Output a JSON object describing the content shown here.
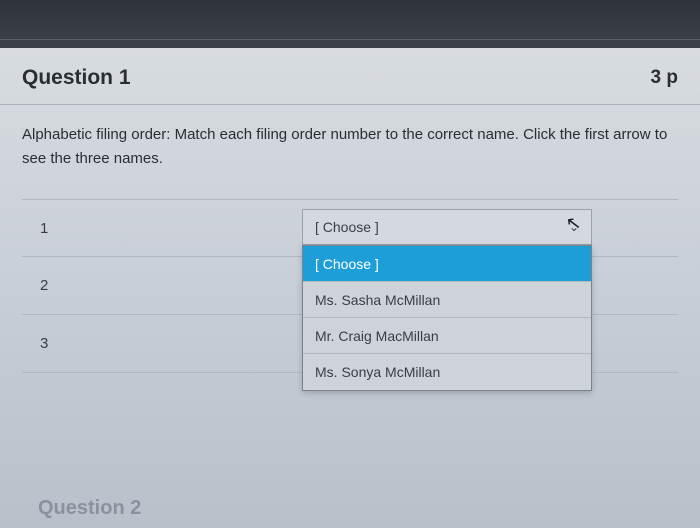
{
  "header": {
    "title": "Question 1",
    "points": "3 p"
  },
  "body": {
    "text": "Alphabetic filing order: Match each filing order number to the correct name. Click the first arrow to see the three names."
  },
  "rows": [
    {
      "num": "1"
    },
    {
      "num": "2"
    },
    {
      "num": "3"
    }
  ],
  "dropdown": {
    "closed_label": "[ Choose ]",
    "options": [
      {
        "label": "[ Choose ]",
        "selected": true
      },
      {
        "label": "Ms. Sasha McMillan",
        "selected": false
      },
      {
        "label": "Mr. Craig MacMillan",
        "selected": false
      },
      {
        "label": "Ms. Sonya McMillan",
        "selected": false
      }
    ]
  },
  "next_question": "Question 2"
}
